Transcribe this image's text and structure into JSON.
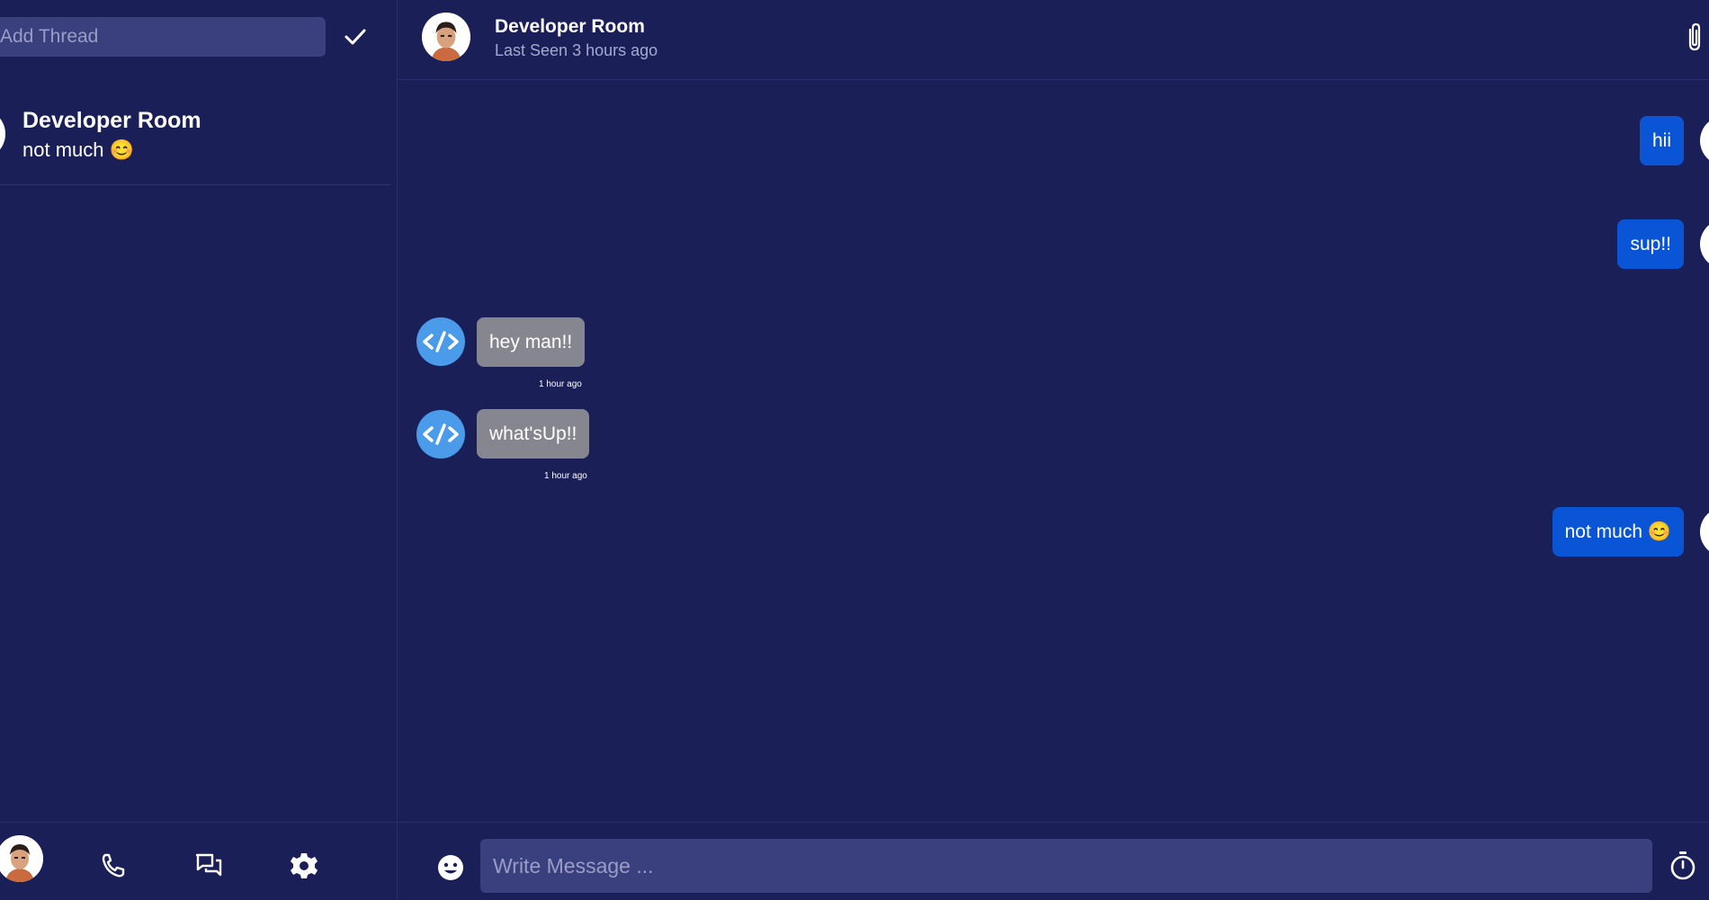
{
  "sidebar": {
    "thread_input": {
      "placeholder": "Add Thread"
    },
    "conversations": [
      {
        "name": "Developer Room",
        "preview": "not much 😊"
      }
    ]
  },
  "bottom_nav": {
    "icons": [
      "user-avatar",
      "phone-icon",
      "chat-icon",
      "gear-icon"
    ]
  },
  "header": {
    "name": "Developer Room",
    "status": "Last Seen 3 hours ago"
  },
  "messages": [
    {
      "direction": "out",
      "text": "hii"
    },
    {
      "direction": "out",
      "text": "sup!!"
    },
    {
      "direction": "in",
      "text": "hey man!!",
      "time": "1 hour ago"
    },
    {
      "direction": "in",
      "text": "what'sUp!!",
      "time": "1 hour ago"
    },
    {
      "direction": "out",
      "text": "not much 😊"
    }
  ],
  "composer": {
    "placeholder": "Write Message ..."
  },
  "colors": {
    "background": "#1b1f58",
    "input": "#3a3f7e",
    "outgoing_bubble": "#0a55d6",
    "incoming_bubble": "#868690",
    "code_avatar": "#4a9bea"
  }
}
